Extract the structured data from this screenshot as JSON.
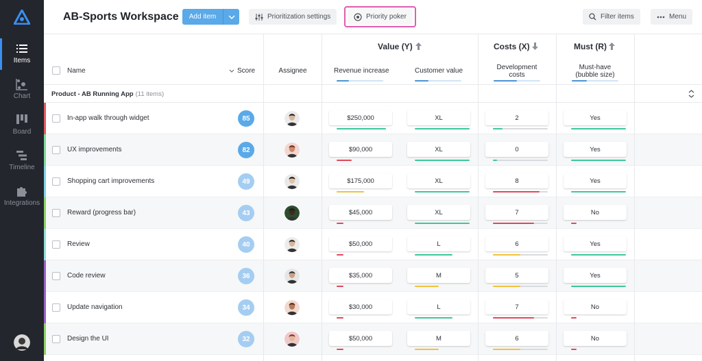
{
  "sidebar": {
    "items": [
      {
        "label": "Items",
        "icon": "list-icon"
      },
      {
        "label": "Chart",
        "icon": "chart-icon"
      },
      {
        "label": "Board",
        "icon": "board-icon"
      },
      {
        "label": "Timeline",
        "icon": "timeline-icon"
      },
      {
        "label": "Integrations",
        "icon": "puzzle-icon"
      }
    ]
  },
  "header": {
    "title": "AB-Sports Workspace",
    "add_item": "Add item",
    "prioritization_settings": "Prioritization settings",
    "priority_poker": "Priority poker",
    "filter_items": "Filter items",
    "menu": "Menu"
  },
  "table": {
    "col_name": "Name",
    "col_score": "Score",
    "col_assignee": "Assignee",
    "group_value": "Value (Y)",
    "group_costs": "Costs (X)",
    "group_must": "Must (R)",
    "col_revenue": "Revenue increase",
    "col_customer": "Customer value",
    "col_dev_line1": "Development",
    "col_dev_line2": "costs",
    "col_must_line1": "Must-have",
    "col_must_line2": "(bubble size)",
    "product_group": "Product - AB Running App",
    "product_count": "(11 items)"
  },
  "colors": {
    "green": "#3cc79a",
    "red": "#e0475a",
    "yellow": "#f0c23a",
    "gray": "#d7dade",
    "score_dark": "#5aa9e8",
    "score_light": "#a5cdf2"
  },
  "rows": [
    {
      "name": "In-app walk through widget",
      "score": "85",
      "revenue": "$250,000",
      "customer": "XL",
      "dev": "2",
      "must": "Yes",
      "stripe": "#e05b5b"
    },
    {
      "name": "UX improvements",
      "score": "82",
      "revenue": "$90,000",
      "customer": "XL",
      "dev": "0",
      "must": "Yes",
      "stripe": "#7ed99b"
    },
    {
      "name": "Shopping cart improvements",
      "score": "49",
      "revenue": "$175,000",
      "customer": "XL",
      "dev": "8",
      "must": "Yes",
      "stripe": "#7fd3e8"
    },
    {
      "name": "Reward (progress bar)",
      "score": "43",
      "revenue": "$45,000",
      "customer": "XL",
      "dev": "7",
      "must": "No",
      "stripe": "#8fd26a"
    },
    {
      "name": "Review",
      "score": "40",
      "revenue": "$50,000",
      "customer": "L",
      "dev": "6",
      "must": "Yes",
      "stripe": "#8fe0d8"
    },
    {
      "name": "Code review",
      "score": "36",
      "revenue": "$35,000",
      "customer": "M",
      "dev": "5",
      "must": "Yes",
      "stripe": "#9a62c9"
    },
    {
      "name": "Update navigation",
      "score": "34",
      "revenue": "$30,000",
      "customer": "L",
      "dev": "7",
      "must": "No",
      "stripe": "#9a62c9"
    },
    {
      "name": "Design the UI",
      "score": "32",
      "revenue": "$50,000",
      "customer": "M",
      "dev": "6",
      "must": "No",
      "stripe": "#8fd26a"
    }
  ]
}
